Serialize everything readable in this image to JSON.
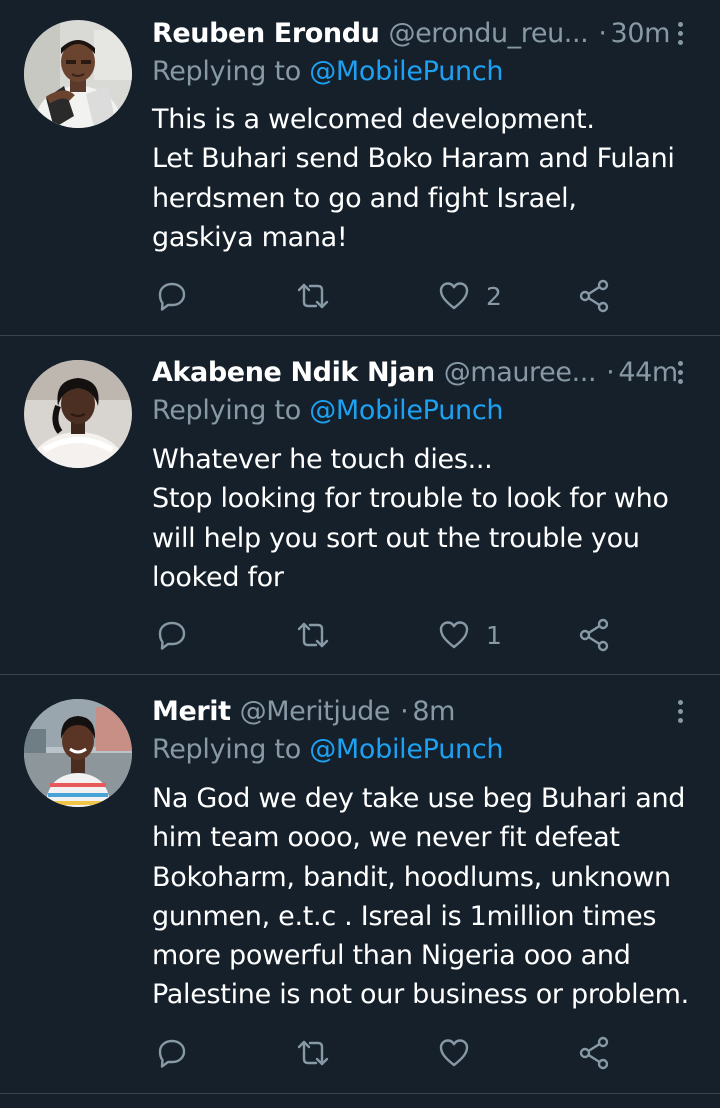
{
  "reply_prefix": "Replying to",
  "tweets": [
    {
      "name": "Reuben Erondu",
      "handle": "@erondu_reu...",
      "time": "30m",
      "reply_to": "@MobilePunch",
      "lines": [
        "This is a welcomed development.",
        "Let Buhari send Boko Haram and Fulani",
        "herdsmen to go and fight Israel,",
        "gaskiya mana!"
      ],
      "likes": "2"
    },
    {
      "name": "Akabene Ndik Njan",
      "handle": "@mauree...",
      "time": "44m",
      "reply_to": "@MobilePunch",
      "lines": [
        "Whatever he touch dies...",
        "Stop looking for trouble to look for who",
        "will help you sort out the trouble you",
        "looked for"
      ],
      "likes": "1"
    },
    {
      "name": "Merit",
      "handle": "@Meritjude",
      "time": "8m",
      "reply_to": "@MobilePunch",
      "lines": [
        "Na God we dey take use beg Buhari and",
        "him team oooo, we never fit defeat",
        "Bokoharm, bandit, hoodlums, unknown",
        "gunmen, e.t.c . Isreal is 1million times",
        "more powerful than Nigeria ooo and",
        "Palestine is not our business or problem."
      ],
      "likes": ""
    }
  ],
  "colors": {
    "background": "#15202b",
    "secondary_text": "#8899a6",
    "mention": "#1da1f2",
    "divider": "#38444d"
  },
  "icons": [
    "reply-icon",
    "retweet-icon",
    "like-icon",
    "share-icon",
    "more-options-icon"
  ]
}
